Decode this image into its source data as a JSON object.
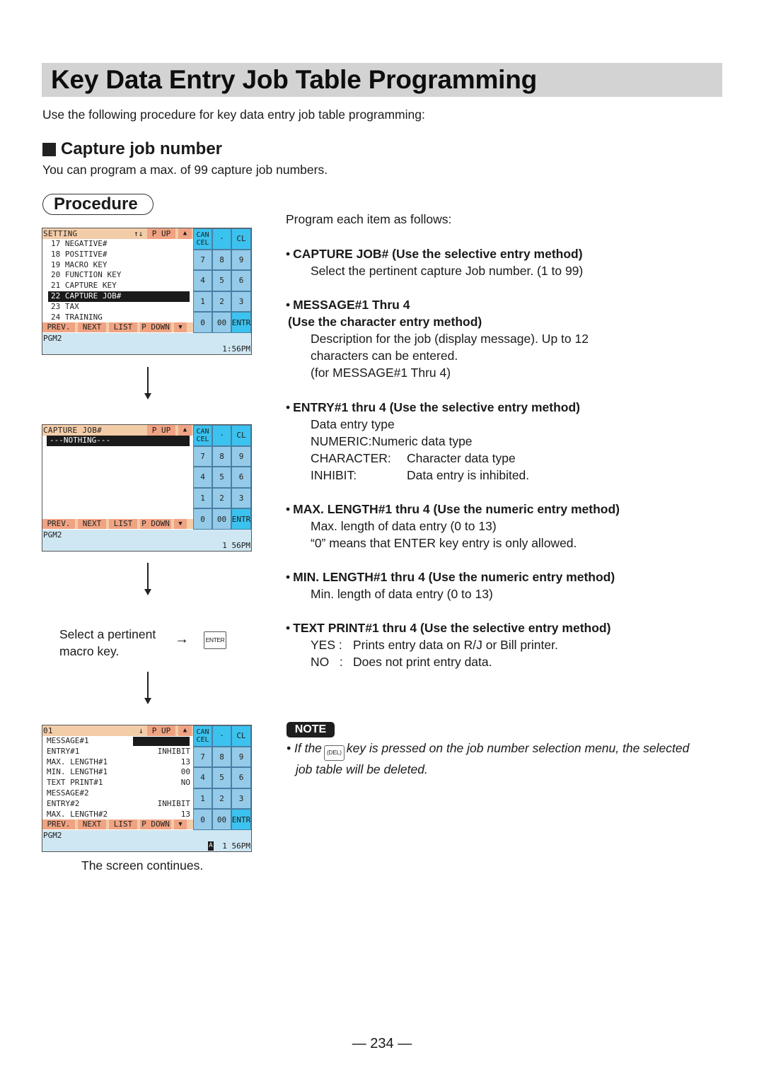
{
  "page": {
    "title": "Key Data Entry Job Table Programming",
    "intro": "Use the following procedure for key data entry job table programming:",
    "section_heading": "Capture job number",
    "section_subtext": "You can program a max. of 99 capture job numbers.",
    "procedure_label": "Procedure",
    "page_number": "— 234 —"
  },
  "keypad": {
    "cancel_top": "CAN",
    "cancel_bottom": "CEL",
    "dot": "·",
    "cl": "CL",
    "digits": [
      "7",
      "8",
      "9",
      "4",
      "5",
      "6",
      "1",
      "2",
      "3",
      "0",
      "00"
    ],
    "enter": "ENTR"
  },
  "screens": [
    {
      "title": "SETTING",
      "arrows": "↑↓",
      "page_up": "P UP",
      "up_icon": "▲",
      "lines": [
        "17 NEGATIVE#",
        "18 POSITIVE#",
        "19 MACRO KEY",
        "20 FUNCTION KEY",
        "21 CAPTURE KEY",
        "22 CAPTURE JOB#",
        "23 TAX",
        "24 TRAINING"
      ],
      "selected_index": 5,
      "footer": [
        "PREV.",
        "NEXT",
        "LIST",
        "P DOWN",
        "▼"
      ],
      "mode": "PGM2",
      "time": "1:56PM"
    },
    {
      "title": "CAPTURE JOB#",
      "arrows": "",
      "page_up": "P UP",
      "up_icon": "▲",
      "lines": [
        "---NOTHING---"
      ],
      "selected_index": 0,
      "footer": [
        "PREV.",
        "NEXT",
        "LIST",
        "P DOWN",
        "▼"
      ],
      "mode": "PGM2",
      "time": "1 56PM"
    },
    {
      "title": "01",
      "arrows": "↓",
      "page_up": "P UP",
      "up_icon": "▲",
      "fields": [
        {
          "label": "MESSAGE#1",
          "value": ""
        },
        {
          "label": "ENTRY#1",
          "value": "INHIBIT"
        },
        {
          "label": "MAX. LENGTH#1",
          "value": "13"
        },
        {
          "label": "MIN. LENGTH#1",
          "value": "00"
        },
        {
          "label": "TEXT PRINT#1",
          "value": "NO"
        },
        {
          "label": "MESSAGE#2",
          "value": ""
        },
        {
          "label": "ENTRY#2",
          "value": "INHIBIT"
        },
        {
          "label": "MAX. LENGTH#2",
          "value": "13"
        }
      ],
      "footer": [
        "PREV.",
        "NEXT",
        "LIST",
        "P DOWN",
        "▼"
      ],
      "mode": "PGM2",
      "badge": "A",
      "time": "1 56PM"
    }
  ],
  "steps": {
    "macro_line1": "Select a pertinent",
    "macro_line2": "macro key.",
    "arrow": "→",
    "enter_key": "ENTER",
    "screen_continues": "The screen continues."
  },
  "instructions": {
    "lead": "Program each item as follows:",
    "items": [
      {
        "head": "CAPTURE JOB# (Use the selective entry method)",
        "lines": [
          "Select the pertinent capture Job number. (1 to 99)"
        ]
      },
      {
        "head": "MESSAGE#1 Thru 4",
        "head2": "(Use the character entry method)",
        "lines": [
          "Description for the job (display message). Up to 12",
          "characters can be entered.",
          "(for MESSAGE#1 Thru 4)"
        ]
      },
      {
        "head": "ENTRY#1 thru 4 (Use the selective entry method)",
        "lines": [
          "Data entry type"
        ],
        "options": [
          {
            "k": "NUMERIC:",
            "v": "Numeric data type"
          },
          {
            "k": "CHARACTER:",
            "v": "Character data type"
          },
          {
            "k": "INHIBIT:",
            "v": "Data entry is inhibited."
          }
        ]
      },
      {
        "head": "MAX. LENGTH#1 thru 4 (Use the numeric entry method)",
        "lines": [
          "Max. length of data entry (0 to 13)",
          "“0” means that ENTER key entry is only allowed."
        ]
      },
      {
        "head": "MIN. LENGTH#1 thru 4 (Use the numeric entry method)",
        "lines": [
          "Min. length of data entry (0 to 13)"
        ]
      },
      {
        "head": "TEXT PRINT#1 thru 4 (Use the selective entry method)",
        "options": [
          {
            "k": "YES :",
            "v": "Prints entry data on R/J or Bill printer."
          },
          {
            "k": "NO   :",
            "v": "Does not print entry data."
          }
        ]
      }
    ]
  },
  "note": {
    "label": "NOTE",
    "before_key": "If the",
    "key": "(DEL)",
    "after_key": "key is pressed on the job number selection menu, the selected",
    "line2": "job table will be deleted."
  }
}
